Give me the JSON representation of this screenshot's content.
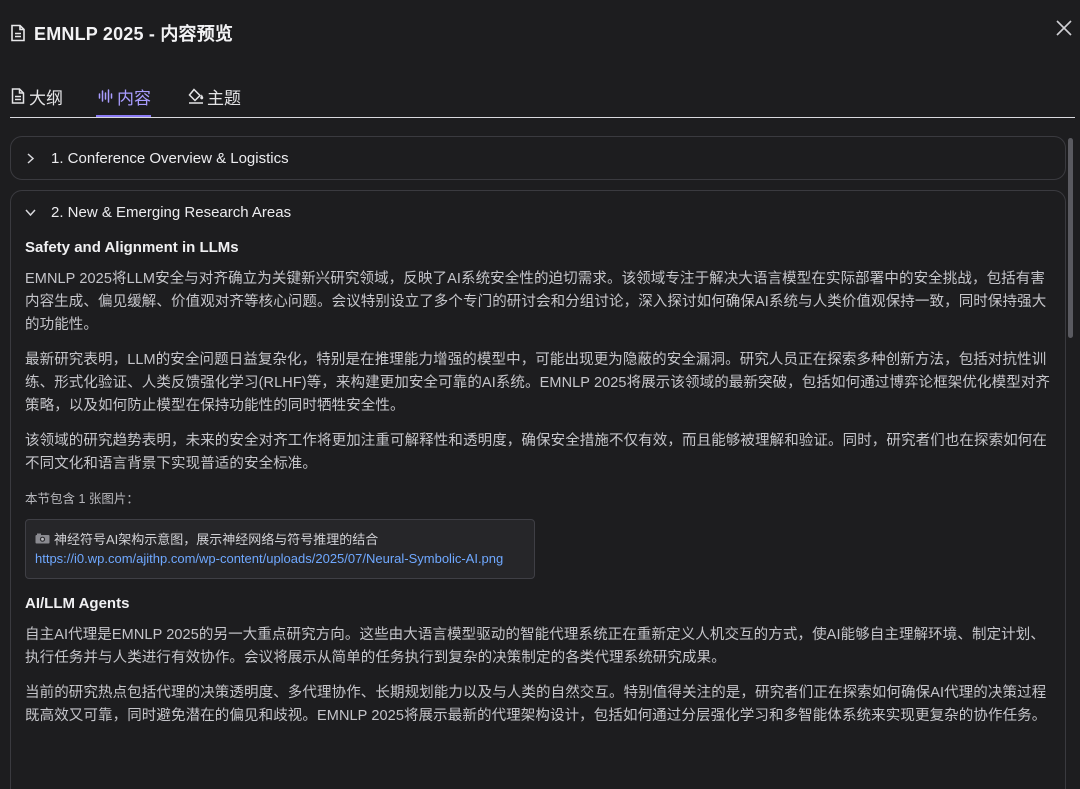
{
  "header": {
    "title": "EMNLP 2025  - 内容预览"
  },
  "tabs": [
    {
      "label": "大纲",
      "icon": "file-text-icon"
    },
    {
      "label": "内容",
      "icon": "audio-wave-icon",
      "active": true
    },
    {
      "label": "主题",
      "icon": "paint-bucket-icon"
    }
  ],
  "colors": {
    "background": "#1d1d1f",
    "accent": "#a99dff",
    "link": "#6fa8ff"
  },
  "sections": [
    {
      "title": "1. Conference Overview & Logistics",
      "expanded": false
    },
    {
      "title": "2. New & Emerging Research Areas",
      "expanded": true,
      "subsections": [
        {
          "heading": "Safety and Alignment in LLMs",
          "paragraphs": [
            "EMNLP 2025将LLM安全与对齐确立为关键新兴研究领域，反映了AI系统安全性的迫切需求。该领域专注于解决大语言模型在实际部署中的安全挑战，包括有害内容生成、偏见缓解、价值观对齐等核心问题。会议特别设立了多个专门的研讨会和分组讨论，深入探讨如何确保AI系统与人类价值观保持一致，同时保持强大的功能性。",
            "最新研究表明，LLM的安全问题日益复杂化，特别是在推理能力增强的模型中，可能出现更为隐蔽的安全漏洞。研究人员正在探索多种创新方法，包括对抗性训练、形式化验证、人类反馈强化学习(RLHF)等，来构建更加安全可靠的AI系统。EMNLP 2025将展示该领域的最新突破，包括如何通过博弈论框架优化模型对齐策略，以及如何防止模型在保持功能性的同时牺牲安全性。",
            "该领域的研究趋势表明，未来的安全对齐工作将更加注重可解释性和透明度，确保安全措施不仅有效，而且能够被理解和验证。同时，研究者们也在探索如何在不同文化和语言背景下实现普适的安全标准。"
          ],
          "image_count_text": "本节包含 1 张图片：",
          "image": {
            "icon": "camera-icon",
            "description": "神经符号AI架构示意图，展示神经网络与符号推理的结合",
            "url": "https://i0.wp.com/ajithp.com/wp-content/uploads/2025/07/Neural-Symbolic-AI.png"
          }
        },
        {
          "heading": "AI/LLM Agents",
          "paragraphs": [
            "自主AI代理是EMNLP 2025的另一大重点研究方向。这些由大语言模型驱动的智能代理系统正在重新定义人机交互的方式，使AI能够自主理解环境、制定计划、执行任务并与人类进行有效协作。会议将展示从简单的任务执行到复杂的决策制定的各类代理系统研究成果。",
            "当前的研究热点包括代理的决策透明度、多代理协作、长期规划能力以及与人类的自然交互。特别值得关注的是，研究者们正在探索如何确保AI代理的决策过程既高效又可靠，同时避免潜在的偏见和歧视。EMNLP 2025将展示最新的代理架构设计，包括如何通过分层强化学习和多智能体系统来实现更复杂的协作任务。"
          ]
        }
      ]
    }
  ]
}
